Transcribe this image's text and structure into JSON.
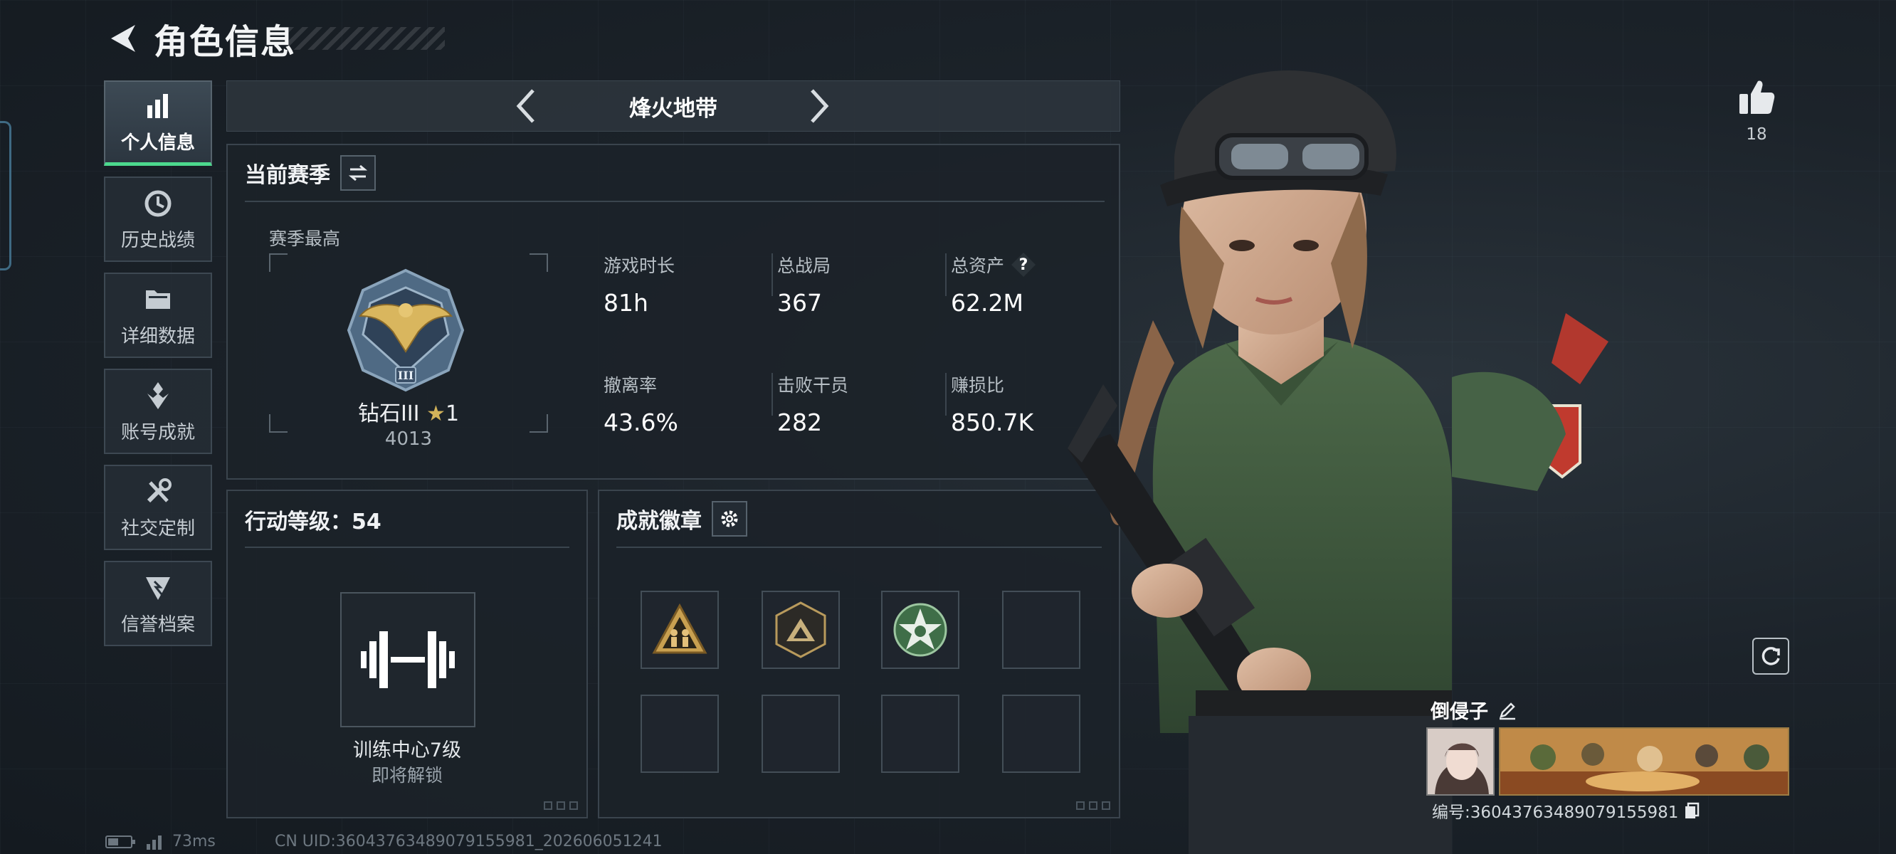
{
  "header": {
    "title": "角色信息"
  },
  "sidebar": {
    "items": [
      {
        "label": "个人信息",
        "icon": "bar-chart-icon",
        "active": true
      },
      {
        "label": "历史战绩",
        "icon": "history-clock-icon",
        "active": false
      },
      {
        "label": "详细数据",
        "icon": "folder-icon",
        "active": false
      },
      {
        "label": "账号成就",
        "icon": "achievement-icon",
        "active": false
      },
      {
        "label": "社交定制",
        "icon": "tools-icon",
        "active": false
      },
      {
        "label": "信誉档案",
        "icon": "credit-shield-icon",
        "active": false
      }
    ]
  },
  "mode": {
    "title": "烽火地带"
  },
  "season": {
    "title": "当前赛季",
    "subtitle": "赛季最高",
    "rank_name": "钻石III",
    "rank_star": "★",
    "rank_stars": "1",
    "rank_score": "4013",
    "stats": [
      {
        "label": "游戏时长",
        "value": "81h"
      },
      {
        "label": "总战局",
        "value": "367"
      },
      {
        "label": "总资产",
        "value": "62.2M",
        "help": "?"
      },
      {
        "label": "撤离率",
        "value": "43.6%"
      },
      {
        "label": "击败干员",
        "value": "282"
      },
      {
        "label": "赚损比",
        "value": "850.7K"
      }
    ]
  },
  "level": {
    "title": "行动等级：54",
    "caption": "训练中心7级",
    "sub": "即将解锁"
  },
  "achievements": {
    "title": "成就徽章",
    "badges": [
      "triangle-soldiers-badge",
      "hexagon-mountain-badge",
      "green-star-badge",
      "",
      "",
      "",
      "",
      ""
    ]
  },
  "profile": {
    "likes": "18",
    "player_name": "倒侵子",
    "player_id": "编号:3604376348907915598​1"
  },
  "status": {
    "ping": "73ms",
    "uid": "CN UID:36043763489079155981_202606051241"
  },
  "colors": {
    "accent": "#4cd88d",
    "gold": "#d2b35a"
  }
}
